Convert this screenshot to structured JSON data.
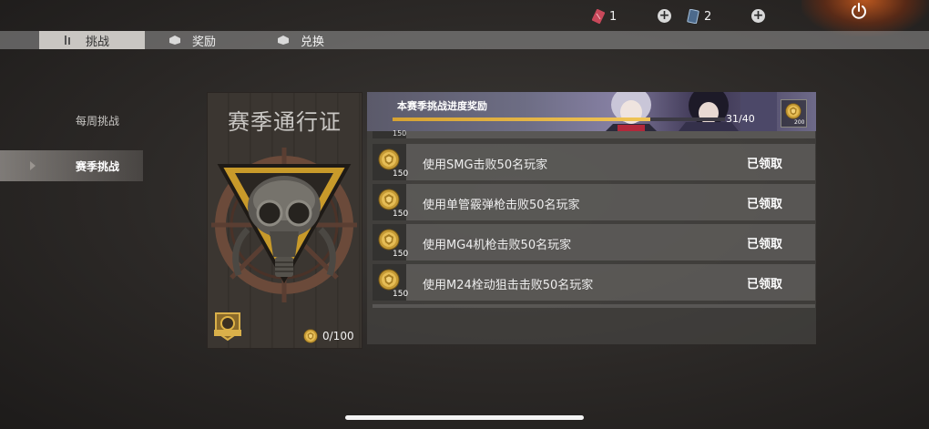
{
  "colors": {
    "accent_gold": "#e0b445",
    "tab_active_bg": "#c9c6c2",
    "tab_bar_bg": "#8f8f8f"
  },
  "topbar": {
    "currency1": {
      "icon": "ticket-icon",
      "value": "1"
    },
    "currency2": {
      "icon": "card-icon",
      "value": "2"
    },
    "power_icon": "power-icon"
  },
  "tabs": [
    {
      "label": "挑战",
      "icon": "challenge-icon",
      "active": true
    },
    {
      "label": "奖励",
      "icon": "reward-icon",
      "active": false
    },
    {
      "label": "兑换",
      "icon": "exchange-icon",
      "active": false
    }
  ],
  "leftnav": [
    {
      "label": "每周挑战",
      "selected": false
    },
    {
      "label": "赛季挑战",
      "selected": true
    }
  ],
  "season_card": {
    "title": "赛季通行证",
    "progress_text": "0/100",
    "progress_fraction": 0.0
  },
  "challenge_panel": {
    "banner_title": "本赛季挑战进度奖励",
    "progress_text": "31/40",
    "progress_fraction": 0.775,
    "reward_amount": "200",
    "partial_top_amount": "150",
    "rows": [
      {
        "reward": "150",
        "desc": "使用SMG击败50名玩家",
        "status": "已领取"
      },
      {
        "reward": "150",
        "desc": "使用单管霰弹枪击败50名玩家",
        "status": "已领取"
      },
      {
        "reward": "150",
        "desc": "使用MG4机枪击败50名玩家",
        "status": "已领取"
      },
      {
        "reward": "150",
        "desc": "使用M24栓动狙击击败50名玩家",
        "status": "已领取"
      }
    ]
  }
}
